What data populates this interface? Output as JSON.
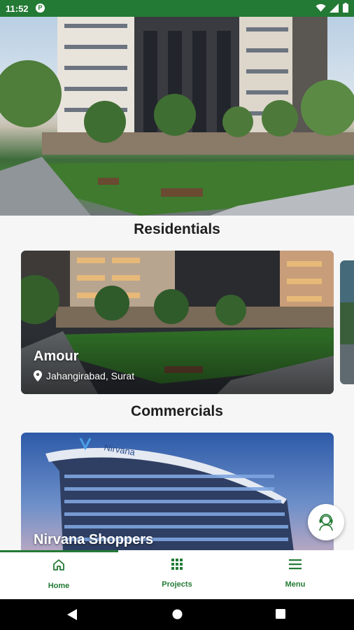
{
  "status_bar": {
    "time": "11:52",
    "badge": "P"
  },
  "sections": {
    "residentials": "Residentials",
    "commercials": "Commercials"
  },
  "residential_cards": [
    {
      "title": "Amour",
      "location": "Jahangirabad, Surat"
    }
  ],
  "commercial_cards": [
    {
      "title": "Nirvana Shoppers",
      "sign": "Nirvana"
    }
  ],
  "bottom_nav": {
    "items": [
      {
        "label": "Home",
        "icon": "home-icon",
        "active": true
      },
      {
        "label": "Projects",
        "icon": "grid-icon",
        "active": false
      },
      {
        "label": "Menu",
        "icon": "hamburger-icon",
        "active": false
      }
    ]
  },
  "colors": {
    "brand_green": "#237a35"
  }
}
